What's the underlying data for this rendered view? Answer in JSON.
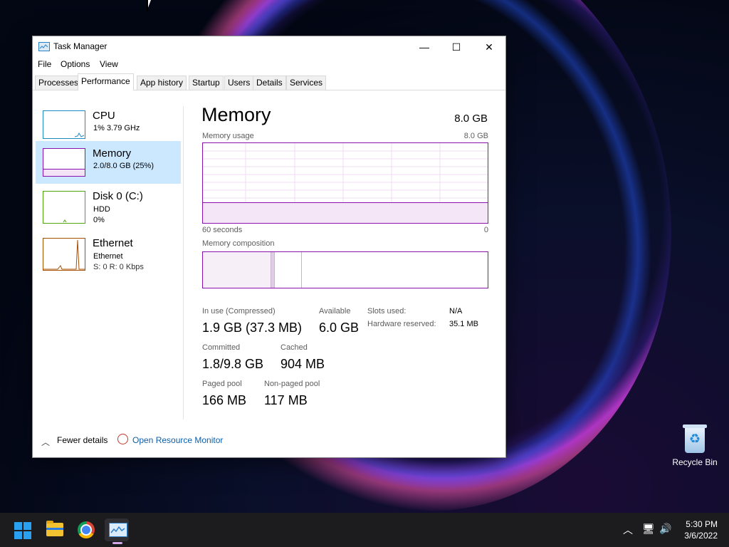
{
  "window": {
    "title": "Task Manager",
    "controls": {
      "minimize": "—",
      "maximize": "☐",
      "close": "✕"
    }
  },
  "menu": [
    "File",
    "Options",
    "View"
  ],
  "tabs": [
    "Processes",
    "Performance",
    "App history",
    "Startup",
    "Users",
    "Details",
    "Services"
  ],
  "active_tab": "Performance",
  "sidebar": [
    {
      "title": "CPU",
      "line1": "1%  3.79 GHz",
      "line2": ""
    },
    {
      "title": "Memory",
      "line1": "2.0/8.0 GB (25%)",
      "line2": ""
    },
    {
      "title": "Disk 0 (C:)",
      "line1": "HDD",
      "line2": "0%"
    },
    {
      "title": "Ethernet",
      "line1": "Ethernet",
      "line2": "S: 0  R: 0 Kbps"
    }
  ],
  "main": {
    "title": "Memory",
    "total": "8.0 GB",
    "usage_label": "Memory usage",
    "usage_max": "8.0 GB",
    "time_left": "60 seconds",
    "time_right": "0",
    "composition_label": "Memory composition",
    "usage_fraction": 0.25
  },
  "stats": {
    "in_use_label": "In use (Compressed)",
    "in_use_value": "1.9 GB (37.3 MB)",
    "available_label": "Available",
    "available_value": "6.0 GB",
    "committed_label": "Committed",
    "committed_value": "1.8/9.8 GB",
    "cached_label": "Cached",
    "cached_value": "904 MB",
    "paged_label": "Paged pool",
    "paged_value": "166 MB",
    "nonpaged_label": "Non-paged pool",
    "nonpaged_value": "117 MB",
    "slots_label": "Slots used:",
    "slots_value": "N/A",
    "hwres_label": "Hardware reserved:",
    "hwres_value": "35.1 MB"
  },
  "footer": {
    "fewer_details": "Fewer details",
    "open_resmon": "Open Resource Monitor"
  },
  "desktop": {
    "recycle_bin": "Recycle Bin"
  },
  "taskbar": {
    "time": "5:30 PM",
    "date": "3/6/2022"
  },
  "colors": {
    "memory_accent": "#8b12ae",
    "cpu_accent": "#1b8cc4",
    "disk_accent": "#4da60c",
    "ethernet_accent": "#a74f01",
    "selection": "#cce8ff",
    "link": "#0f5ea8"
  }
}
